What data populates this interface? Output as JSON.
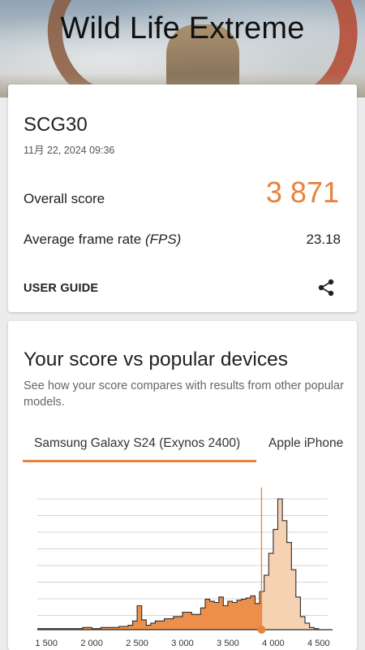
{
  "header": {
    "title": "Wild Life Extreme"
  },
  "result": {
    "device_name": "SCG30",
    "date": "11月 22, 2024 09:36",
    "overall_label": "Overall score",
    "overall_score": "3 871",
    "fps_label_prefix": "Average frame rate ",
    "fps_label_unit": "(FPS)",
    "fps_value": "23.18",
    "user_guide_label": "USER GUIDE",
    "share_icon": "share-icon"
  },
  "comparison": {
    "title": "Your score vs popular devices",
    "subtitle": "See how your score compares with results from other popular models.",
    "tabs": [
      {
        "label": "Samsung Galaxy S24 (Exynos 2400)",
        "active": true
      },
      {
        "label": "Apple iPhone"
      }
    ]
  },
  "colors": {
    "accent": "#e8823d",
    "fill": "#ec8f4a",
    "fill_light": "#f6d2b3"
  },
  "chart_data": {
    "type": "area",
    "x_ticks": [
      "1 500",
      "2 000",
      "2 500",
      "3 000",
      "3 500",
      "4 000",
      "4 500"
    ],
    "xlim": [
      1400,
      4600
    ],
    "marker_value": 3871,
    "x": [
      1400,
      1500,
      1700,
      1900,
      2000,
      2100,
      2200,
      2300,
      2400,
      2450,
      2500,
      2550,
      2600,
      2650,
      2700,
      2800,
      2900,
      3000,
      3100,
      3200,
      3250,
      3300,
      3350,
      3400,
      3450,
      3500,
      3550,
      3600,
      3650,
      3700,
      3750,
      3800,
      3850,
      3900,
      3950,
      4000,
      4050,
      4100,
      4150,
      4200,
      4250,
      4300,
      4350,
      4400,
      4450,
      4500
    ],
    "y": [
      1,
      1,
      1,
      2,
      1,
      2,
      2,
      3,
      4,
      8,
      22,
      9,
      4,
      6,
      8,
      10,
      12,
      16,
      14,
      20,
      28,
      26,
      25,
      30,
      22,
      26,
      25,
      27,
      28,
      29,
      31,
      24,
      35,
      50,
      70,
      92,
      120,
      100,
      80,
      55,
      30,
      12,
      6,
      2,
      1,
      0
    ]
  }
}
